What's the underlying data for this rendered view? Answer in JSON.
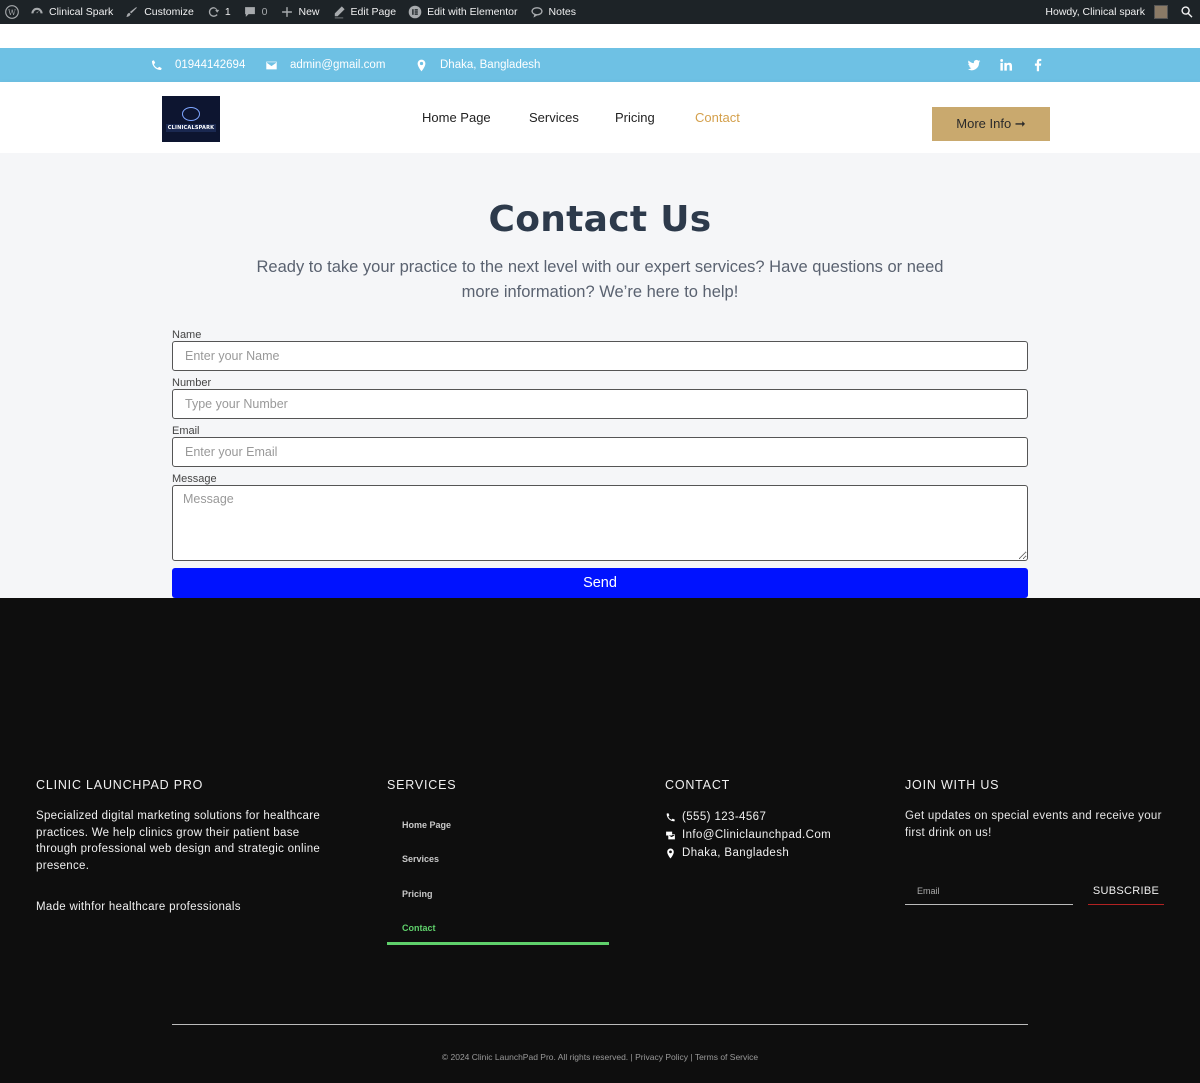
{
  "admin_bar": {
    "site_name": "Clinical Spark",
    "customize": "Customize",
    "updates_count": "1",
    "comments_count": "0",
    "new": "New",
    "edit_page": "Edit Page",
    "edit_elementor": "Edit with Elementor",
    "notes": "Notes",
    "howdy": "Howdy, Clinical spark"
  },
  "topbar": {
    "phone": "01944142694",
    "email": "admin@gmail.com",
    "location": "Dhaka, Bangladesh",
    "social": [
      "twitter-icon",
      "linkedin-icon",
      "facebook-icon"
    ]
  },
  "header": {
    "logo_text": "CLINICALSPARK",
    "nav": [
      {
        "label": "Home Page",
        "active": false
      },
      {
        "label": "Services",
        "active": false
      },
      {
        "label": "Pricing",
        "active": false
      },
      {
        "label": "Contact",
        "active": true
      }
    ],
    "more_info": "More Info ➞"
  },
  "contact": {
    "title": "Contact Us",
    "lead": "Ready to take your practice to the next level with our expert services? Have questions or need more information? We’re here to help!",
    "fields": {
      "name": {
        "label": "Name",
        "placeholder": "Enter your Name"
      },
      "number": {
        "label": "Number",
        "placeholder": "Type your Number"
      },
      "email": {
        "label": "Email",
        "placeholder": "Enter your Email"
      },
      "message": {
        "label": "Message",
        "placeholder": "Message"
      }
    },
    "send": "Send"
  },
  "footer": {
    "about_title": "CLINIC LAUNCHPAD PRO",
    "about_text": "Specialized digital marketing solutions for healthcare practices. We help clinics grow their patient base through professional web design and strategic online presence.",
    "made_with": "Made withfor healthcare professionals",
    "services_title": "SERVICES",
    "services": [
      "Home Page",
      "Services",
      "Pricing",
      "Contact"
    ],
    "contact_title": "CONTACT",
    "contact_phone": "(555) 123-4567",
    "contact_email": "Info@Cliniclaunchpad.Com",
    "contact_location": "Dhaka, Bangladesh",
    "join_title": "JOIN WITH US",
    "join_text": "Get updates on special events and receive your first drink on us!",
    "email_placeholder": "Email",
    "subscribe": "SUBSCRIBE",
    "copyright": "© 2024 Clinic LaunchPad Pro. All rights reserved. |",
    "privacy": "Privacy Policy",
    "sep": "|",
    "terms": "Terms of Service"
  },
  "colors": {
    "topbar_bg": "#6ec1e4",
    "accent_gold": "#c9a96e",
    "active_nav": "#d4a04c",
    "send_button": "#0012ff",
    "footer_bg": "#0e0e0e",
    "footer_active": "#5fd06b"
  }
}
